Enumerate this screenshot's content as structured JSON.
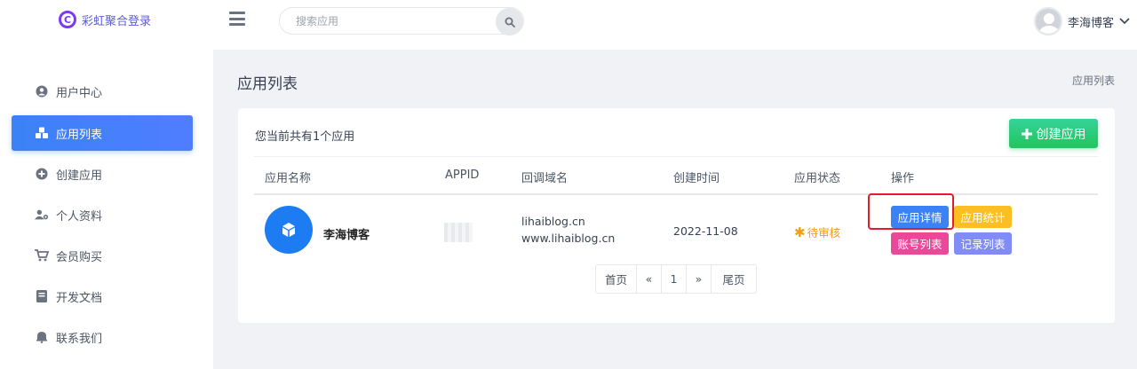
{
  "app": {
    "logo_letter": "C",
    "title": "彩虹聚合登录"
  },
  "search": {
    "placeholder": "搜索应用"
  },
  "user": {
    "name": "李海博客"
  },
  "sidebar": {
    "items": [
      {
        "label": "用户中心",
        "icon": "user-circle-icon"
      },
      {
        "label": "应用列表",
        "icon": "cubes-icon",
        "active": true
      },
      {
        "label": "创建应用",
        "icon": "plus-circle-icon"
      },
      {
        "label": "个人资料",
        "icon": "user-gear-icon"
      },
      {
        "label": "会员购买",
        "icon": "cart-icon"
      },
      {
        "label": "开发文档",
        "icon": "book-icon"
      },
      {
        "label": "联系我们",
        "icon": "bell-icon"
      }
    ]
  },
  "page": {
    "title": "应用列表",
    "breadcrumb": "应用列表"
  },
  "card": {
    "count_text": "您当前共有1个应用",
    "create_label": "创建应用"
  },
  "table": {
    "headers": [
      "应用名称",
      "APPID",
      "回调域名",
      "创建时间",
      "应用状态",
      "操作"
    ],
    "rows": [
      {
        "name": "李海博客",
        "appid": "",
        "domains": [
          "lihaiblog.cn",
          "www.lihaiblog.cn"
        ],
        "created": "2022-11-08",
        "status": "待审核",
        "actions": [
          "应用详情",
          "应用统计",
          "账号列表",
          "记录列表"
        ]
      }
    ]
  },
  "pagination": {
    "first": "首页",
    "prev": "«",
    "current": "1",
    "next": "»",
    "last": "尾页"
  },
  "colors": {
    "accent": "#3b82f6",
    "create": "#22c55e",
    "status_pending": "#f59e0b",
    "btn_detail": "#3b82f6",
    "btn_stats": "#fbbf24",
    "btn_accounts": "#ec4899",
    "btn_records": "#818cf8",
    "highlight": "#e11d2b"
  }
}
